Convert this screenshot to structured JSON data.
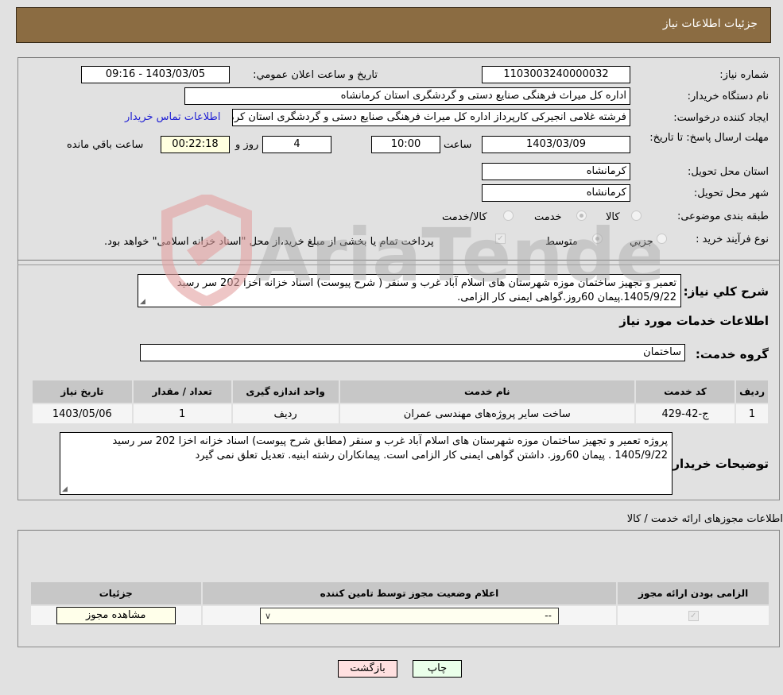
{
  "header": {
    "title": "جزئیات اطلاعات نیاز"
  },
  "fields": {
    "need_number_label": "شماره نیاز:",
    "need_number": "1103003240000032",
    "announce_label": "تاريخ و ساعت اعلان عمومي:",
    "announce_value": "1403/03/05 - 09:16",
    "buyer_org_label": "نام دستگاه خريدار:",
    "buyer_org": "اداره کل میراث فرهنگی  صنایع دستی و گردشگری استان کرمانشاه",
    "creator_label": "ايجاد کننده درخواست:",
    "creator": "فرشته غلامی انجیرکی کارپرداز اداره کل میراث فرهنگی  صنایع دستی و گردشگری استان کرمانشاه",
    "buyer_contact_link": "اطلاعات تماس خريدار",
    "deadline_label": "مهلت ارسال پاسخ: تا تاريخ:",
    "deadline_date": "1403/03/09",
    "time_label": "ساعت",
    "deadline_time": "10:00",
    "days_value": "4",
    "days_label": "روز و",
    "remaining_time": "00:22:18",
    "remaining_label": "ساعت باقي مانده",
    "province_label": "استان محل تحويل:",
    "province": "کرمانشاه",
    "city_label": "شهر محل تحويل:",
    "city": "کرمانشاه",
    "category_label": "طبقه بندی موضوعی:",
    "category_options": [
      {
        "label": "کالا",
        "checked": false
      },
      {
        "label": "خدمت",
        "checked": true
      },
      {
        "label": "کالا/خدمت",
        "checked": false
      }
    ],
    "process_label": "نوع فرآيند خريد :",
    "process_options": [
      {
        "label": "جزيي",
        "checked": false
      },
      {
        "label": "متوسط",
        "checked": true
      }
    ],
    "treasury_note": "پرداخت تمام يا بخشی از مبلغ خريد،از محل \"اسناد خزانه اسلامی\" خواهد بود.",
    "treasury_checked": true
  },
  "description": {
    "label": "شرح کلي نياز:",
    "text": "تعمیر و تجهیز ساختمان موزه شهرستان های اسلام آباد غرب و سنقر ( شرح پیوست) اسناد خزانه اخزا 202 سر رسید 1405/9/22.پیمان 60روز.گواهی ایمنی کار الزامی."
  },
  "services_section": {
    "title": "اطلاعات خدمات مورد نياز",
    "group_label": "گروه خدمت:",
    "group_value": "ساختمان",
    "table": {
      "headers": [
        "رديف",
        "کد خدمت",
        "نام خدمت",
        "واحد اندازه گيری",
        "تعداد / مقدار",
        "تاريخ نياز"
      ],
      "rows": [
        [
          "1",
          "ج-42-429",
          "ساخت سایر پروژه‌های مهندسی عمران",
          "رديف",
          "1",
          "1403/05/06"
        ]
      ]
    }
  },
  "buyer_notes": {
    "label": "توضيحات خريدار:",
    "text": "پروژه تعمیر و تجهیز ساختمان موزه شهرستان های اسلام آباد غرب و سنقر (مطابق شرح پیوست) اسناد خزانه اخزا 202 سر رسید 1405/9/22 . پیمان 60روز. داشتن گواهی ایمنی کار الزامی است. پیمانکاران رشته ابنیه. تعدیل تعلق نمی گیرد"
  },
  "permits": {
    "title": "اطلاعات مجوزهای ارائه خدمت / کالا",
    "headers": [
      "الزامی بودن ارائه مجوز",
      "اعلام وضعيت مجوز توسط تامين کننده",
      "جزئيات"
    ],
    "row": {
      "required_checked": true,
      "status_select": "--",
      "view_button": "مشاهده مجوز"
    }
  },
  "footer": {
    "print_button": "چاپ",
    "back_button": "بازگشت"
  },
  "watermark": {
    "text": "AriaTender.neT"
  },
  "colors": {
    "header_bg": "#8b6c42",
    "page_bg": "#e1e1e1",
    "link": "#1f1fd4",
    "print_bg": "#eaffea",
    "back_bg": "#ffe0e0",
    "yellow_field": "#ffffe0"
  }
}
